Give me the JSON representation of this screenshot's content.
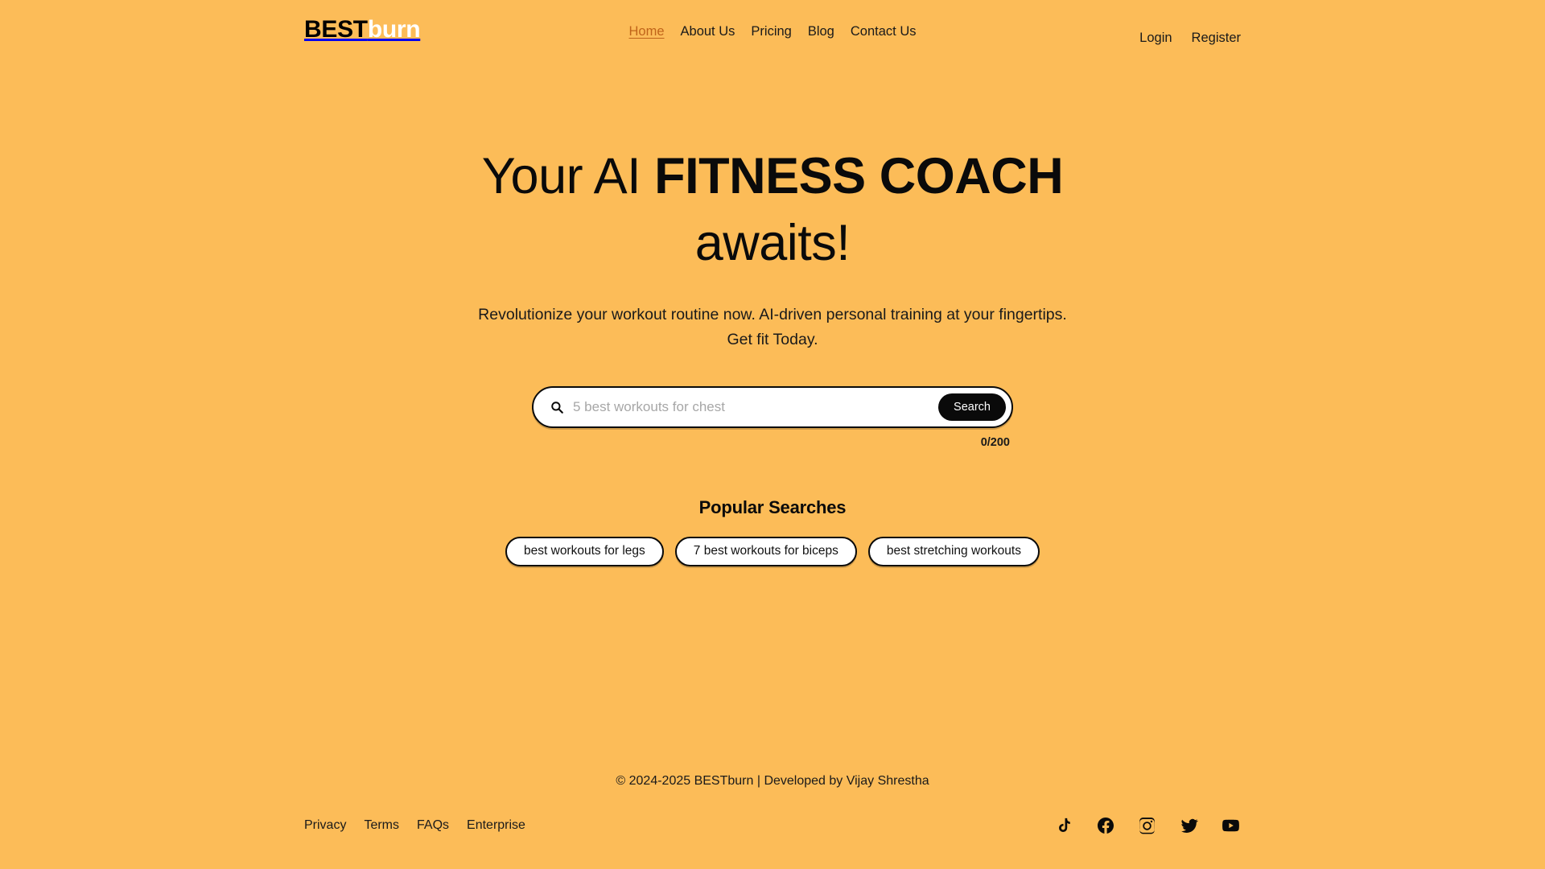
{
  "theme": {
    "background": "#fcbc58",
    "text": "#111111",
    "accent": "#c0641a",
    "button_bg": "#0a0a0a",
    "button_text": "#ffffff",
    "chip_bg": "#ffffff",
    "logo_burn_color": "#ffffff"
  },
  "header": {
    "brand": {
      "part_bold_dark": "BEST",
      "part_light": "burn"
    },
    "nav_items": [
      {
        "label": "Home",
        "active": true
      },
      {
        "label": "About Us",
        "active": false
      },
      {
        "label": "Pricing",
        "active": false
      },
      {
        "label": "Blog",
        "active": false
      },
      {
        "label": "Contact Us",
        "active": false
      }
    ],
    "auth": {
      "login_label": "Login",
      "register_label": "Register"
    }
  },
  "hero": {
    "title_line1_regular": "Your AI ",
    "title_line1_bold": "FITNESS",
    "title_line2_bold": "COACH",
    "title_line2_regular": " awaits!",
    "subtitle": "Revolutionize your workout routine now. AI-driven personal training at your fingertips. Get fit Today."
  },
  "search": {
    "icon": "search-icon",
    "value": "",
    "placeholder": "5 best workouts for chest",
    "submit_label": "Search",
    "counter": "0/200",
    "max_length": 200
  },
  "popular": {
    "title": "Popular Searches",
    "chips": [
      {
        "label": "best workouts for legs"
      },
      {
        "label": "7 best workouts for biceps"
      },
      {
        "label": "best stretching workouts"
      }
    ]
  },
  "footer": {
    "copyright": "© 2024-2025 BESTburn | Developed by Vijay Shrestha",
    "links": [
      {
        "label": "Privacy"
      },
      {
        "label": "Terms"
      },
      {
        "label": "FAQs"
      },
      {
        "label": "Enterprise"
      }
    ],
    "social": [
      {
        "name": "tiktok-icon"
      },
      {
        "name": "facebook-icon"
      },
      {
        "name": "instagram-icon"
      },
      {
        "name": "twitter-icon"
      },
      {
        "name": "youtube-icon"
      }
    ]
  }
}
